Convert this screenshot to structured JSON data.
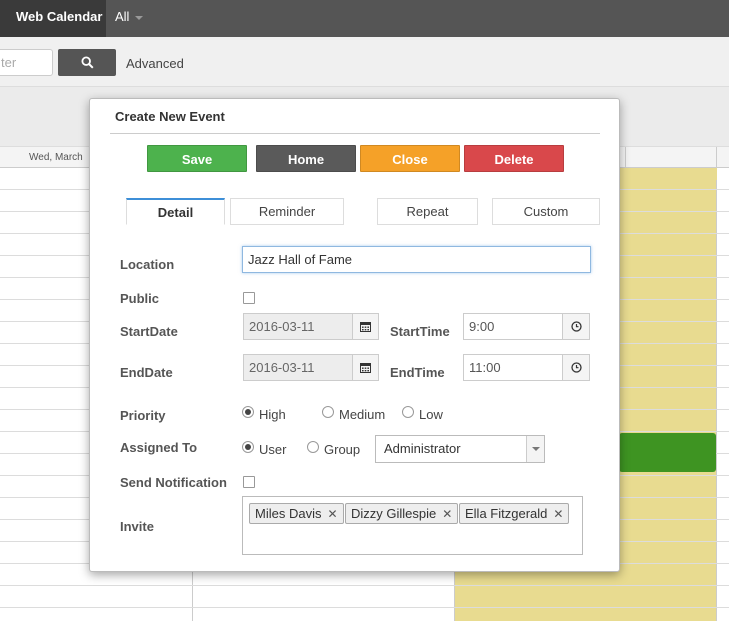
{
  "topbar": {
    "brand": "Web Calendar",
    "filter": "All"
  },
  "toolbar": {
    "search_placeholder": "ter",
    "advanced": "Advanced"
  },
  "calendar": {
    "day_header": "Wed, March"
  },
  "modal": {
    "title": "Create New Event",
    "buttons": {
      "save": "Save",
      "home": "Home",
      "close": "Close",
      "delete": "Delete"
    },
    "tabs": [
      "Detail",
      "Reminder",
      "Repeat",
      "Custom"
    ],
    "labels": {
      "location": "Location",
      "public": "Public",
      "start_date": "StartDate",
      "start_time": "StartTime",
      "end_date": "EndDate",
      "end_time": "EndTime",
      "priority": "Priority",
      "assigned_to": "Assigned To",
      "send_notification": "Send Notification",
      "invite": "Invite"
    },
    "values": {
      "location": "Jazz Hall of Fame",
      "start_date": "2016-03-11",
      "start_time": "9:00",
      "end_date": "2016-03-11",
      "end_time": "11:00",
      "assignee": "Administrator"
    },
    "priority_options": [
      "High",
      "Medium",
      "Low"
    ],
    "priority_selected": "High",
    "assigned_options": [
      "User",
      "Group"
    ],
    "assigned_selected": "User",
    "invitees": [
      "Miles Davis",
      "Dizzy Gillespie",
      "Ella Fitzgerald"
    ]
  },
  "colors": {
    "save": "#4db24d",
    "home": "#5a5a5a",
    "close": "#f5a128",
    "delete": "#d9484b",
    "event": "#3e9422",
    "highlight_col": "#e8db90"
  }
}
